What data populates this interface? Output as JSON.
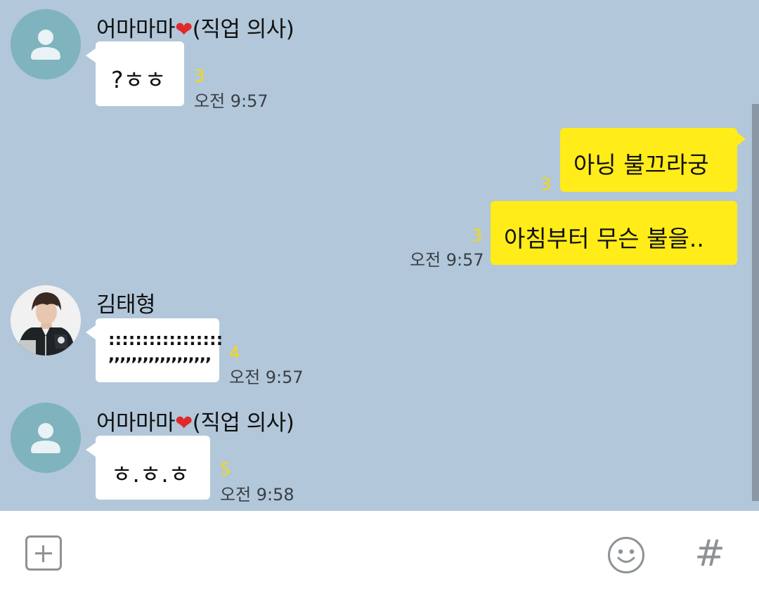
{
  "messages": [
    {
      "sender": "어마마마",
      "sender_suffix": "(직업 의사)",
      "heart": "❤",
      "text": "?ㅎㅎ",
      "unread": "3",
      "time": "오전 9:57"
    },
    {
      "text": "아닝 불끄라궁",
      "unread": "3"
    },
    {
      "text": "아침부터 무슨 불을..",
      "unread": "3",
      "time": "오전 9:57"
    },
    {
      "sender": "김태형",
      "text": ":::::::::::::::::",
      "text2": ",,,,,,,,,,,,,,,,,,",
      "unread": "4",
      "time": "오전 9:57"
    },
    {
      "sender": "어마마마",
      "sender_suffix": "(직업 의사)",
      "heart": "❤",
      "text": "ㅎ.ㅎ.ㅎ",
      "unread": "5",
      "time": "오전 9:58"
    }
  ],
  "input_bar": {
    "plus_icon": "plus-icon",
    "emoji_icon": "emoji-icon",
    "hash_label": "#"
  },
  "colors": {
    "chat_background": "#b2c7da",
    "my_bubble": "#ffec19",
    "their_bubble": "#ffffff",
    "unread_count": "#f5d90c"
  }
}
